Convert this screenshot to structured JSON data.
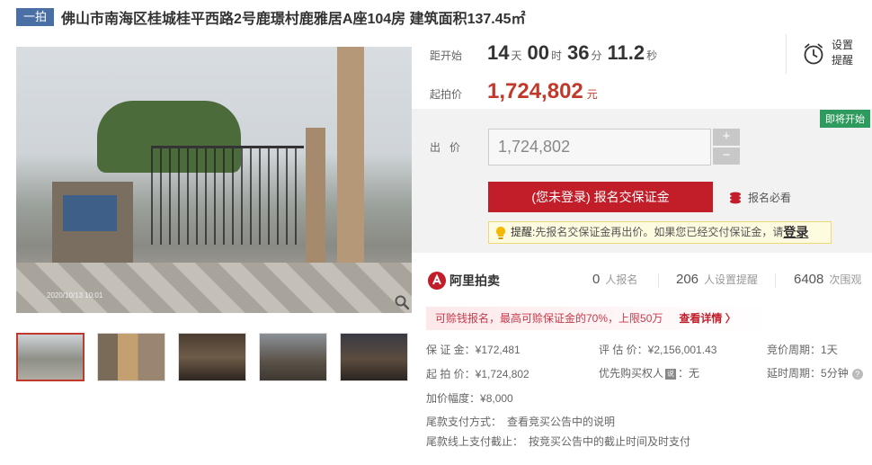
{
  "header": {
    "round_badge": "一拍",
    "title": "佛山市南海区桂城桂平西路2号鹿璟村鹿雅居A座104房 建筑面积137.45㎡"
  },
  "gallery": {
    "photo_timestamp": "2020/10/13 10:01",
    "thumbnails": [
      "t1",
      "t2",
      "t3",
      "t4",
      "t5"
    ]
  },
  "countdown": {
    "label": "距开始",
    "days": "14",
    "days_unit": "天",
    "hours": "00",
    "hours_unit": "时",
    "minutes": "36",
    "minutes_unit": "分",
    "seconds": "11.2",
    "seconds_unit": "秒"
  },
  "remind": {
    "line1": "设置",
    "line2": "提醒"
  },
  "start_price": {
    "label": "起拍价",
    "value": "1,724,802",
    "unit": "元"
  },
  "bid": {
    "soon_badge": "即将开始",
    "label": "出价",
    "input_value": "1,724,802",
    "plus": "+",
    "minus": "−",
    "deposit_button": "(您未登录) 报名交保证金",
    "must_read": "报名必看",
    "tip_prefix": "提醒:",
    "tip_text": "先报名交保证金再出价。如果您已经交付保证金，请",
    "tip_login": "登录"
  },
  "stats": {
    "brand": "阿里拍卖",
    "signups_count": "0",
    "signups_label": "人报名",
    "reminders_count": "206",
    "reminders_label": "人设置提醒",
    "views_count": "6408",
    "views_label": "次围观"
  },
  "promo": {
    "text": "可赊钱报名，最高可赊保证金的70%，上限50万",
    "more": "查看详情 〉"
  },
  "details": {
    "deposit_label": "保 证 金：",
    "deposit_value": "¥172,481",
    "appraisal_label": "评 估 价：",
    "appraisal_value": "¥2,156,001.43",
    "cycle_label": "竞价周期：",
    "cycle_value": "1天",
    "start_label": "起 拍 价：",
    "start_value": "¥1,724,802",
    "priority_label": "优先购买权人",
    "priority_tag": "说",
    "priority_value": "：无",
    "delay_label": "延时周期：",
    "delay_value": "5分钟",
    "increment_label": "加价幅度：",
    "increment_value": "¥8,000",
    "payment_method_label": "尾款支付方式：",
    "payment_method_value": "查看竞买公告中的说明",
    "payment_deadline_label": "尾款线上支付截止：",
    "payment_deadline_value": "按竞买公告中的截止时间及时支付"
  }
}
